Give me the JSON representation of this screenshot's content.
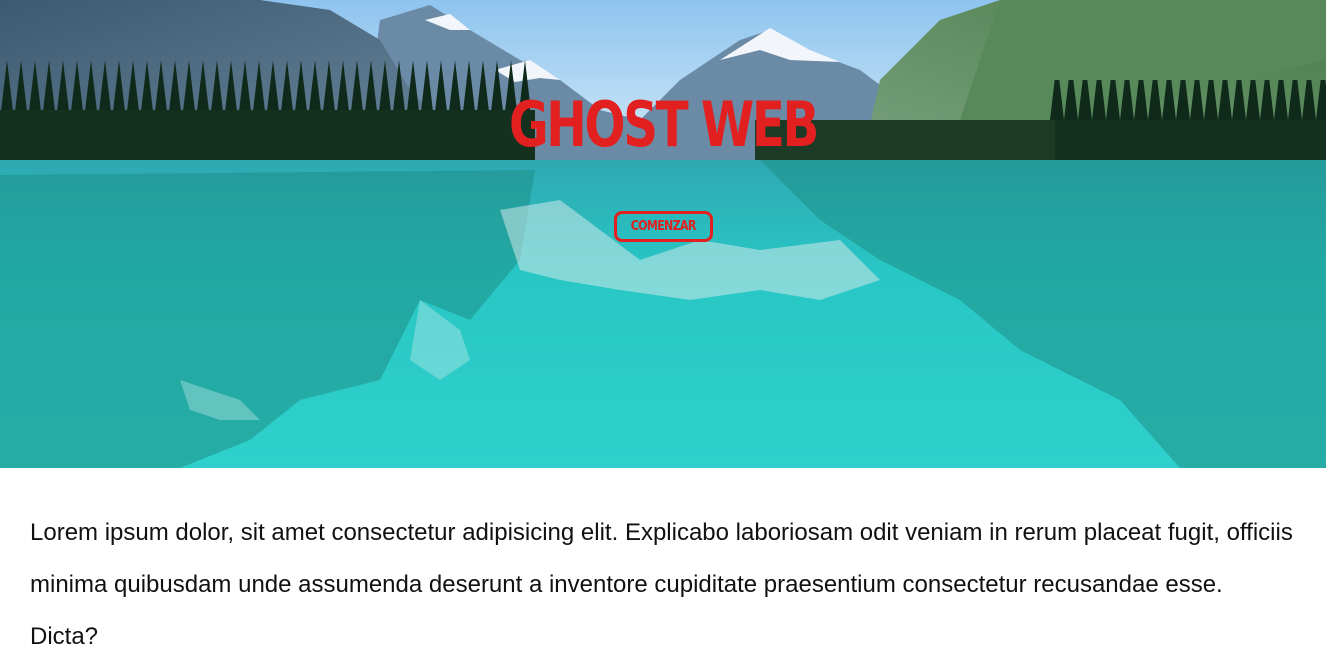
{
  "hero": {
    "title": "GHOST WEB",
    "button_label": "COMENZAR",
    "background": "mountain-lake-photo",
    "accent_color": "#e32020"
  },
  "content": {
    "paragraph": "Lorem ipsum dolor, sit amet consectetur adipisicing elit. Explicabo laboriosam odit veniam in rerum placeat fugit, officiis minima quibusdam unde assumenda deserunt a inventore cupiditate praesentium consectetur recusandae esse. Dicta?"
  }
}
